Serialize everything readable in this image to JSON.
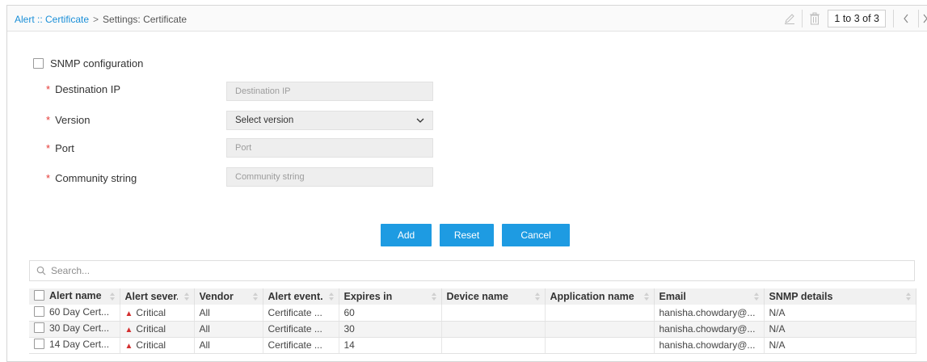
{
  "breadcrumb": {
    "link": "Alert :: Certificate",
    "separator": ">",
    "current": "Settings: Certificate"
  },
  "toolbar": {
    "edit_icon": "pencil-icon",
    "delete_icon": "trash-icon",
    "pager_text": "1 to 3 of 3",
    "prev_icon": "chevron-left-icon"
  },
  "form": {
    "snmp_label": "SNMP configuration",
    "required_mark": "*",
    "destination_ip": {
      "label": "Destination IP",
      "placeholder": "Destination IP"
    },
    "version": {
      "label": "Version",
      "value": "Select version"
    },
    "port": {
      "label": "Port",
      "placeholder": "Port"
    },
    "community": {
      "label": "Community string",
      "placeholder": "Community string"
    }
  },
  "buttons": {
    "add": "Add",
    "reset": "Reset",
    "cancel": "Cancel"
  },
  "search": {
    "placeholder": "Search..."
  },
  "table": {
    "columns": [
      "Alert name",
      "Alert sever...",
      "Vendor",
      "Alert event...",
      "Expires in",
      "Device name",
      "Application name",
      "Email",
      "SNMP details"
    ],
    "rows": [
      {
        "name": "60 Day Cert...",
        "severity": "Critical",
        "vendor": "All",
        "event": "Certificate ...",
        "expires": "60",
        "device": "",
        "application": "",
        "email": "hanisha.chowdary@...",
        "snmp": "N/A"
      },
      {
        "name": "30 Day Cert...",
        "severity": "Critical",
        "vendor": "All",
        "event": "Certificate ...",
        "expires": "30",
        "device": "",
        "application": "",
        "email": "hanisha.chowdary@...",
        "snmp": "N/A"
      },
      {
        "name": "14 Day Cert...",
        "severity": "Critical",
        "vendor": "All",
        "event": "Certificate ...",
        "expires": "14",
        "device": "",
        "application": "",
        "email": "hanisha.chowdary@...",
        "snmp": "N/A"
      }
    ]
  },
  "colors": {
    "accent": "#1e9be2",
    "link": "#1a8fd8",
    "critical": "#d32f2f",
    "required": "#e53935"
  }
}
